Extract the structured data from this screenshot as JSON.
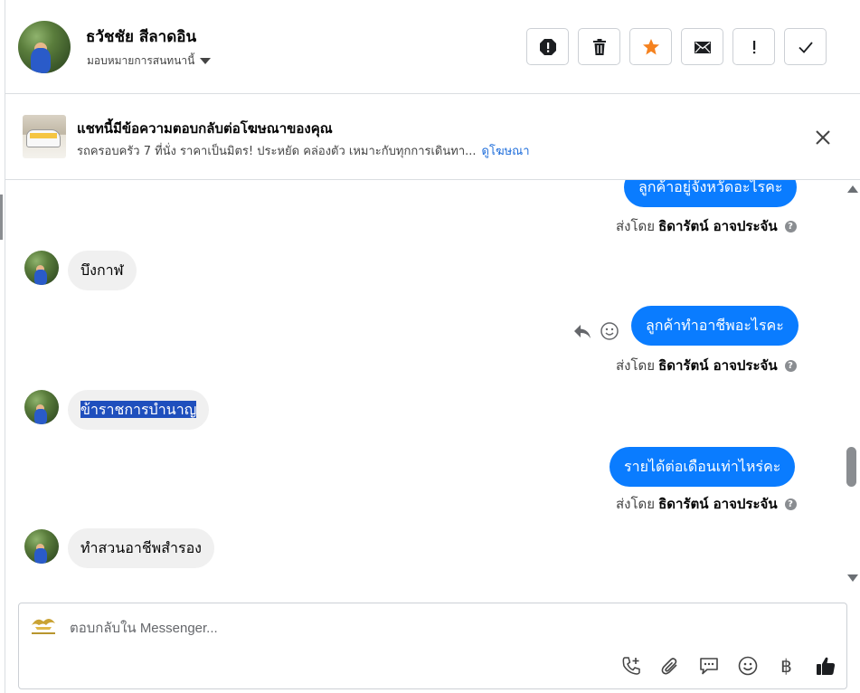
{
  "header": {
    "contact_name": "ธวัชชัย สีลาดอิน",
    "assign_label": "มอบหมายการสนทนานี้",
    "actions": [
      {
        "name": "mark-spam-button",
        "icon": "alert-octagon-icon"
      },
      {
        "name": "delete-button",
        "icon": "trash-icon"
      },
      {
        "name": "star-button",
        "icon": "star-icon"
      },
      {
        "name": "mark-unread-button",
        "icon": "envelope-icon"
      },
      {
        "name": "follow-up-button",
        "icon": "exclamation-icon"
      },
      {
        "name": "mark-done-button",
        "icon": "check-icon"
      }
    ]
  },
  "ad_banner": {
    "title": "แชทนี้มีข้อความตอบกลับต่อโฆษณาของคุณ",
    "description": "รถครอบครัว 7 ที่นั่ง ราคาเป็นมิตร! ประหยัด คล่องตัว เหมาะกับทุกการเดินทา...",
    "link_label": "ดูโฆษณา"
  },
  "messages": [
    {
      "dir": "out",
      "text": "ลูกค้าอยู่จังหวัดอะไรคะ"
    },
    {
      "dir": "meta",
      "prefix": "ส่งโดย",
      "sender": "ธิดารัตน์ อาจประจัน"
    },
    {
      "dir": "in",
      "text": "บึงกาฬ"
    },
    {
      "dir": "out",
      "text": "ลูกค้าทำอาชีพอะไรคะ"
    },
    {
      "dir": "meta",
      "prefix": "ส่งโดย",
      "sender": "ธิดารัตน์ อาจประจัน"
    },
    {
      "dir": "in",
      "text": "ข้าราชการบำนาญ"
    },
    {
      "dir": "out",
      "text": "รายได้ต่อเดือนเท่าไหร่คะ"
    },
    {
      "dir": "meta",
      "prefix": "ส่งโดย",
      "sender": "ธิดารัตน์ อาจประจัน"
    },
    {
      "dir": "in",
      "text": "ทำสวนอาชีพสำรอง"
    }
  ],
  "composer": {
    "placeholder": "ตอบกลับใน Messenger...",
    "currency_symbol": "฿"
  },
  "colors": {
    "accent": "#0a7cff",
    "star": "#f5821f",
    "link": "#216fdb"
  }
}
